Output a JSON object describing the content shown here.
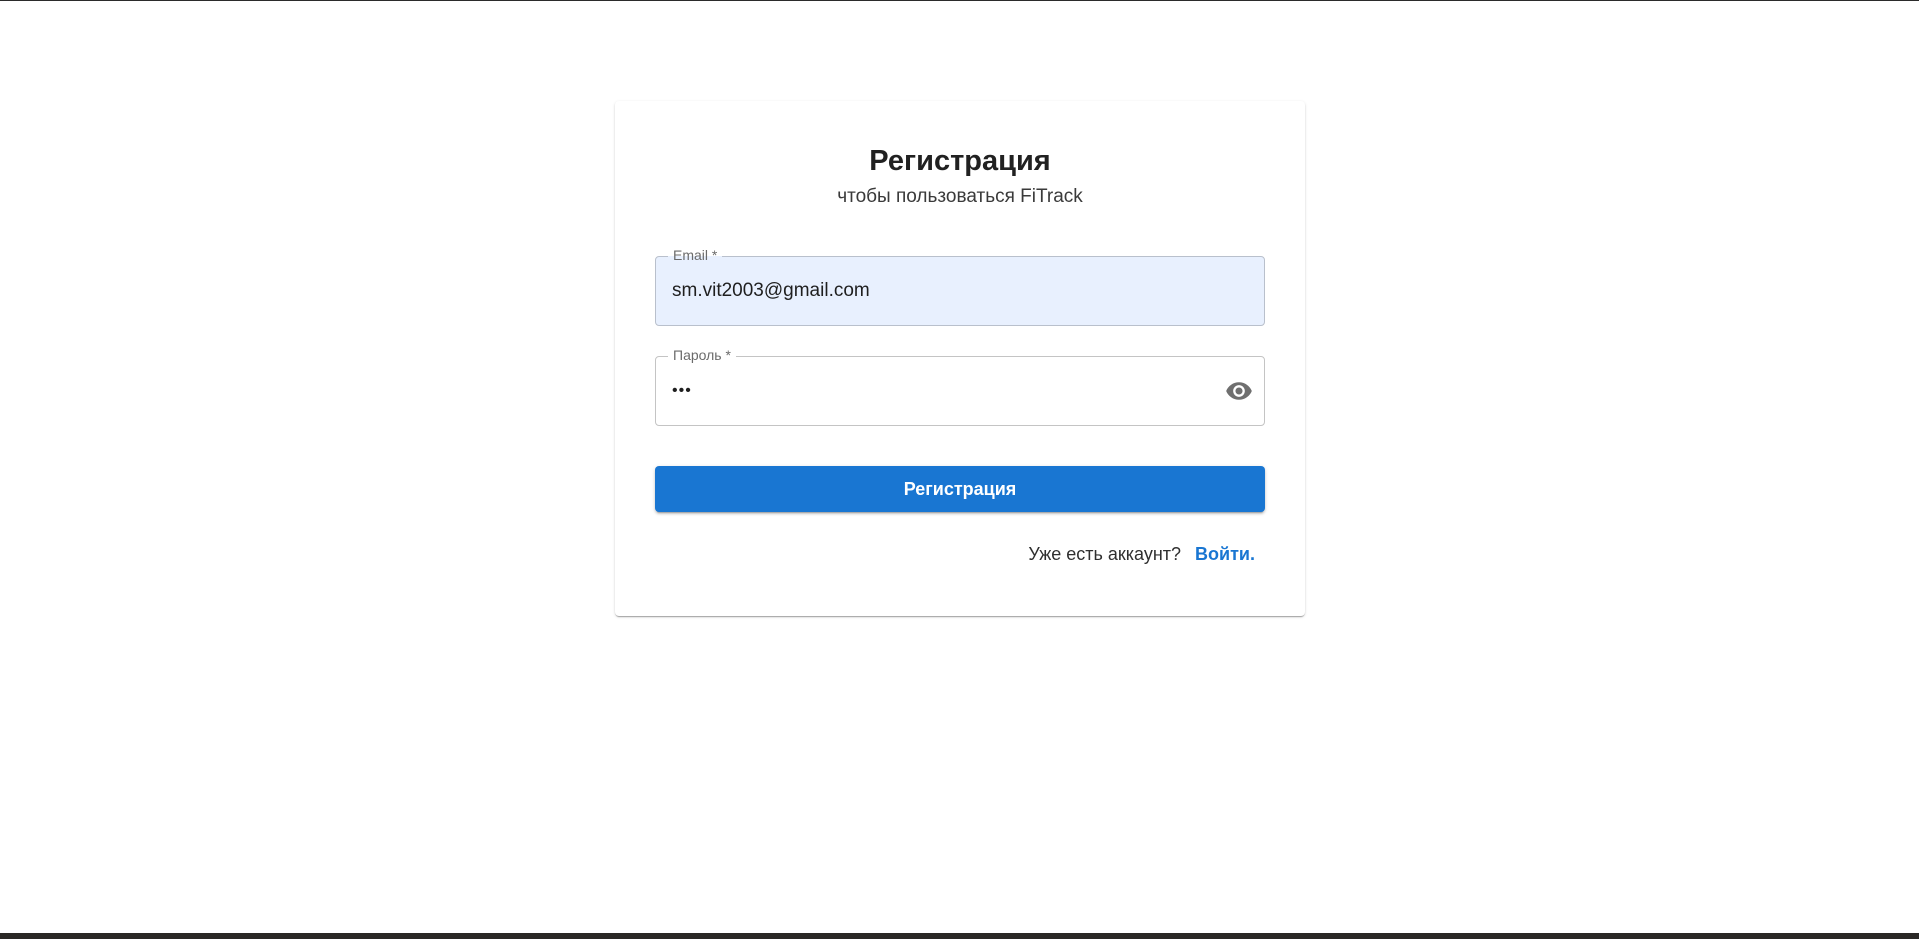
{
  "card": {
    "title": "Регистрация",
    "subtitle": "чтобы пользоваться FiTrack"
  },
  "email_field": {
    "label": "Email *",
    "value": "sm.vit2003@gmail.com"
  },
  "password_field": {
    "label": "Пароль *",
    "masked_value": "•••",
    "toggle_icon": "eye-icon"
  },
  "submit": {
    "label": "Регистрация"
  },
  "signin": {
    "question": "Уже есть аккаунт?",
    "link_label": "Войти."
  },
  "colors": {
    "primary": "#1976d2",
    "autofill_background": "#e8f0fe"
  }
}
